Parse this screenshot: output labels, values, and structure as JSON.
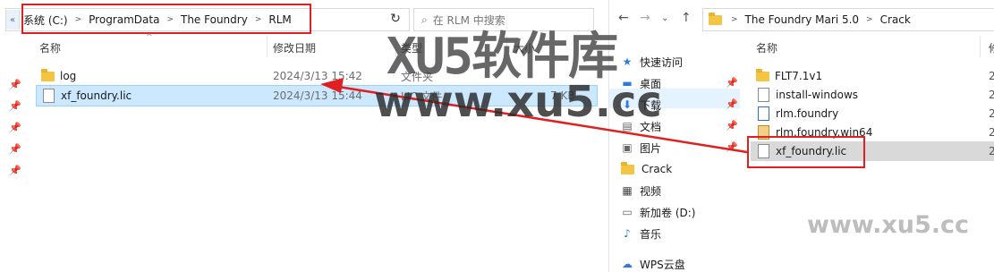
{
  "left": {
    "breadcrumbs": [
      "系统 (C:)",
      "ProgramData",
      "The Foundry",
      "RLM"
    ],
    "search_placeholder": "在 RLM 中搜索",
    "columns": {
      "name": "名称",
      "date": "修改日期",
      "type": "类型",
      "size": "大小"
    },
    "rows": [
      {
        "name": "log",
        "date": "2024/3/13 15:42",
        "type": "文件夹",
        "size": ""
      },
      {
        "name": "xf_foundry.lic",
        "date": "2024/3/13 15:44",
        "type": "LIC 文件",
        "size": "7 KB"
      }
    ]
  },
  "right": {
    "breadcrumbs": [
      "The Foundry Mari 5.0",
      "Crack"
    ],
    "nav": [
      "快速访问",
      "桌面",
      "下载",
      "文档",
      "图片",
      "Crack",
      "视频",
      "新加卷 (D:)",
      "音乐",
      "WPS云盘"
    ],
    "column_name": "名称",
    "column_cut": "修",
    "files": [
      "FLT7.1v1",
      "install-windows",
      "rlm.foundry",
      "rlm.foundry.win64",
      "xf_foundry.lic"
    ],
    "col2_values": [
      "2",
      "2",
      "2",
      "2",
      "2"
    ]
  },
  "watermark": {
    "big": "XU5软件库",
    "mid": "www.xu5.cc",
    "small": "www.xu5.cc"
  },
  "colors": {
    "red": "#e02020",
    "selected": "#cce8ff",
    "folder": "#f4c542"
  }
}
